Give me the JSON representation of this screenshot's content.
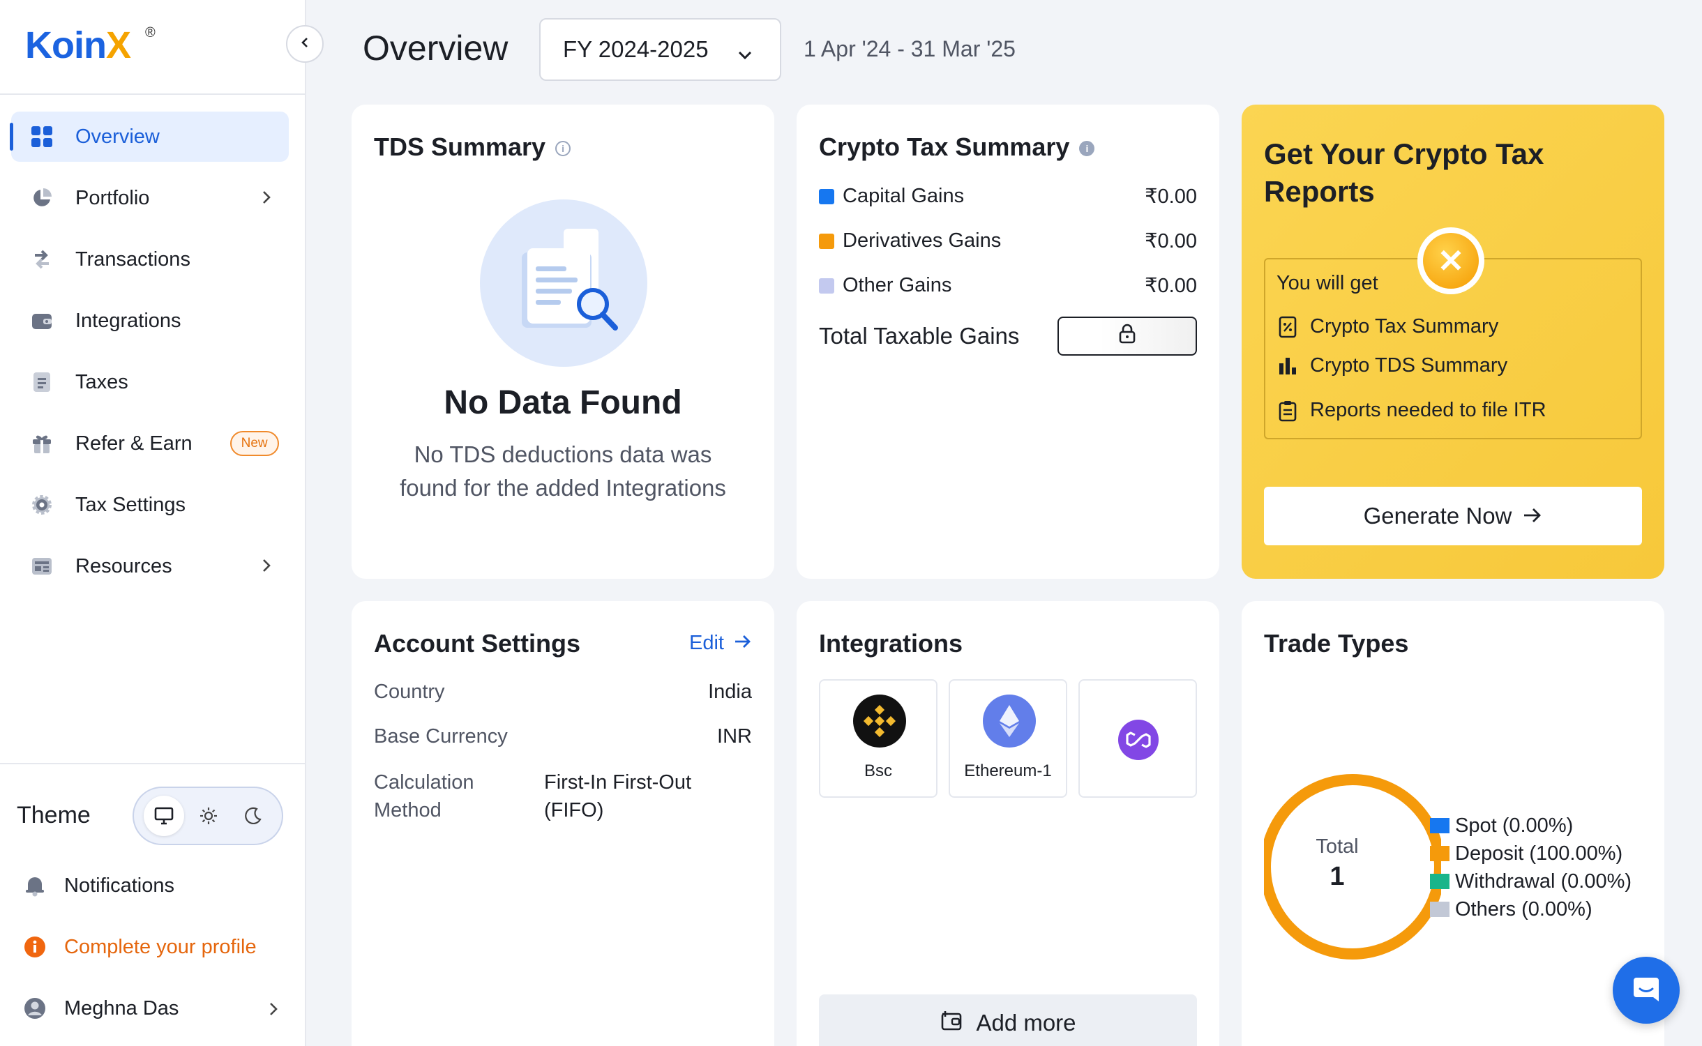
{
  "brand": {
    "name_part1": "Koin",
    "name_part2": "X",
    "reg": "®"
  },
  "sidebar": {
    "items": [
      {
        "label": "Overview"
      },
      {
        "label": "Portfolio"
      },
      {
        "label": "Transactions"
      },
      {
        "label": "Integrations"
      },
      {
        "label": "Taxes"
      },
      {
        "label": "Refer & Earn",
        "badge": "New"
      },
      {
        "label": "Tax Settings"
      },
      {
        "label": "Resources"
      }
    ],
    "theme_label": "Theme",
    "notifications": "Notifications",
    "complete_profile": "Complete your profile",
    "user_name": "Meghna Das"
  },
  "header": {
    "title": "Overview",
    "fy": "FY 2024-2025",
    "date_range": "1 Apr '24 - 31 Mar '25"
  },
  "tds": {
    "title": "TDS Summary",
    "empty_title": "No Data Found",
    "empty_text": "No TDS deductions data was found for the added Integrations"
  },
  "crypto_tax": {
    "title": "Crypto Tax Summary",
    "rows": [
      {
        "label": "Capital Gains",
        "value": "₹0.00",
        "color": "#1677f0"
      },
      {
        "label": "Derivatives Gains",
        "value": "₹0.00",
        "color": "#f59a0b"
      },
      {
        "label": "Other Gains",
        "value": "₹0.00",
        "color": "#c3c9ef"
      }
    ],
    "total_label": "Total Taxable Gains"
  },
  "reports": {
    "title": "Get Your Crypto Tax Reports",
    "you_will_get": "You will get",
    "items": [
      "Crypto Tax Summary",
      "Crypto TDS Summary",
      "Reports needed to file ITR"
    ],
    "button": "Generate Now"
  },
  "account": {
    "title": "Account Settings",
    "edit": "Edit",
    "country_label": "Country",
    "country_value": "India",
    "currency_label": "Base Currency",
    "currency_value": "INR",
    "method_label": "Calculation Method",
    "method_value": "First-In First-Out (FIFO)"
  },
  "integrations": {
    "title": "Integrations",
    "tiles": [
      {
        "name": "Bsc"
      },
      {
        "name": "Ethereum-1"
      },
      {
        "name": ""
      }
    ],
    "add_more": "Add more"
  },
  "trade_types": {
    "title": "Trade Types",
    "total_label": "Total",
    "total_value": "1",
    "legend": [
      {
        "label": "Spot (0.00%)",
        "color": "#1677f0"
      },
      {
        "label": "Deposit (100.00%)",
        "color": "#f59a0b"
      },
      {
        "label": "Withdrawal (0.00%)",
        "color": "#19b58a"
      },
      {
        "label": "Others (0.00%)",
        "color": "#c2c8d6"
      }
    ]
  }
}
